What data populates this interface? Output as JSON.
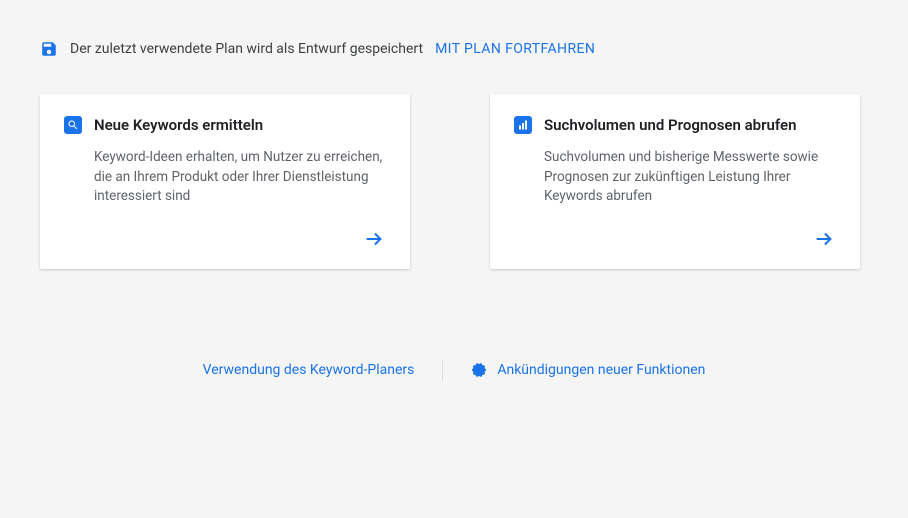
{
  "notice": {
    "text": "Der zuletzt verwendete Plan wird als Entwurf gespeichert",
    "link_label": "MIT PLAN FORTFAHREN"
  },
  "cards": {
    "discover": {
      "title": "Neue Keywords ermitteln",
      "description": "Keyword-Ideen erhalten, um Nutzer zu erreichen, die an Ihrem Produkt oder Ihrer Dienstleistung interessiert sind"
    },
    "forecast": {
      "title": "Suchvolumen und Prognosen abrufen",
      "description": "Suchvolumen und bisherige Messwerte sowie Prognosen zur zukünftigen Leistung Ihrer Keywords abrufen"
    }
  },
  "footer": {
    "usage_link": "Verwendung des Keyword-Planers",
    "announcements_link": "Ankündigungen neuer Funktionen"
  },
  "colors": {
    "primary": "#1a73e8",
    "text": "#3c4043",
    "muted": "#5f6368"
  }
}
